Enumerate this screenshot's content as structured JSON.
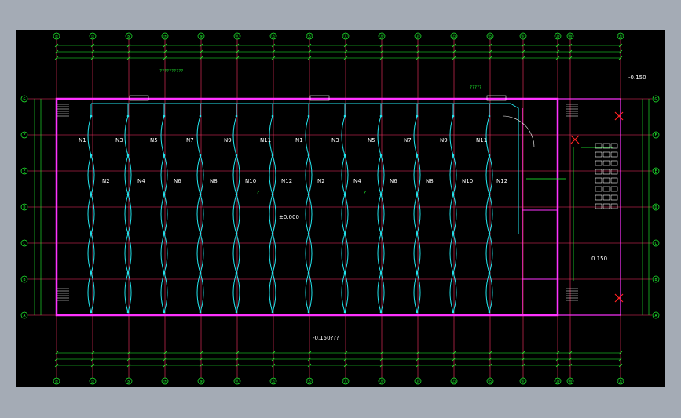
{
  "colors": {
    "background": "#a4abb5",
    "canvas": "#000000",
    "axis_grid": "#ff3366",
    "wall": "#ff33ff",
    "light_circuit": "#22e5ee",
    "dimension": "#22ff33",
    "label": "#ffffff",
    "device_red": "#ff2222"
  },
  "axes": {
    "top": [
      "①",
      "③",
      "⑤",
      "⑦",
      "⑨",
      "⑪",
      "⑬",
      "⑮",
      "⑰",
      "⑲",
      "㉑",
      "㉓",
      "㉕",
      "㉗",
      "㉙",
      "㉚",
      "㉛"
    ],
    "bottom": [
      "①",
      "③",
      "⑤",
      "⑦",
      "⑨",
      "⑪",
      "⑬",
      "⑮",
      "⑰",
      "⑲",
      "㉑",
      "㉓",
      "㉕",
      "㉗",
      "㉙",
      "㉚",
      "㉛"
    ],
    "left": [
      "G",
      "F",
      "E",
      "D",
      "C",
      "B",
      "A"
    ],
    "right": [
      "G",
      "F",
      "E",
      "D",
      "C",
      "B",
      "A"
    ]
  },
  "circuits_row1": [
    "N1",
    "N3",
    "N5",
    "N7",
    "N9",
    "N11",
    "N1",
    "N3",
    "N5",
    "N7",
    "N9",
    "N11"
  ],
  "circuits_row2": [
    "N2",
    "N4",
    "N6",
    "N8",
    "N10",
    "N12",
    "N2",
    "N4",
    "N6",
    "N8",
    "N10",
    "N12"
  ],
  "elevations": {
    "top_right": "-0.150",
    "center": "±0.000",
    "bottom": "-0.150???",
    "stair": "0.150"
  },
  "annotations": {
    "marker_q1": "?",
    "marker_q2": "?",
    "panel_top": "??????????",
    "panel_top2": "?????"
  }
}
